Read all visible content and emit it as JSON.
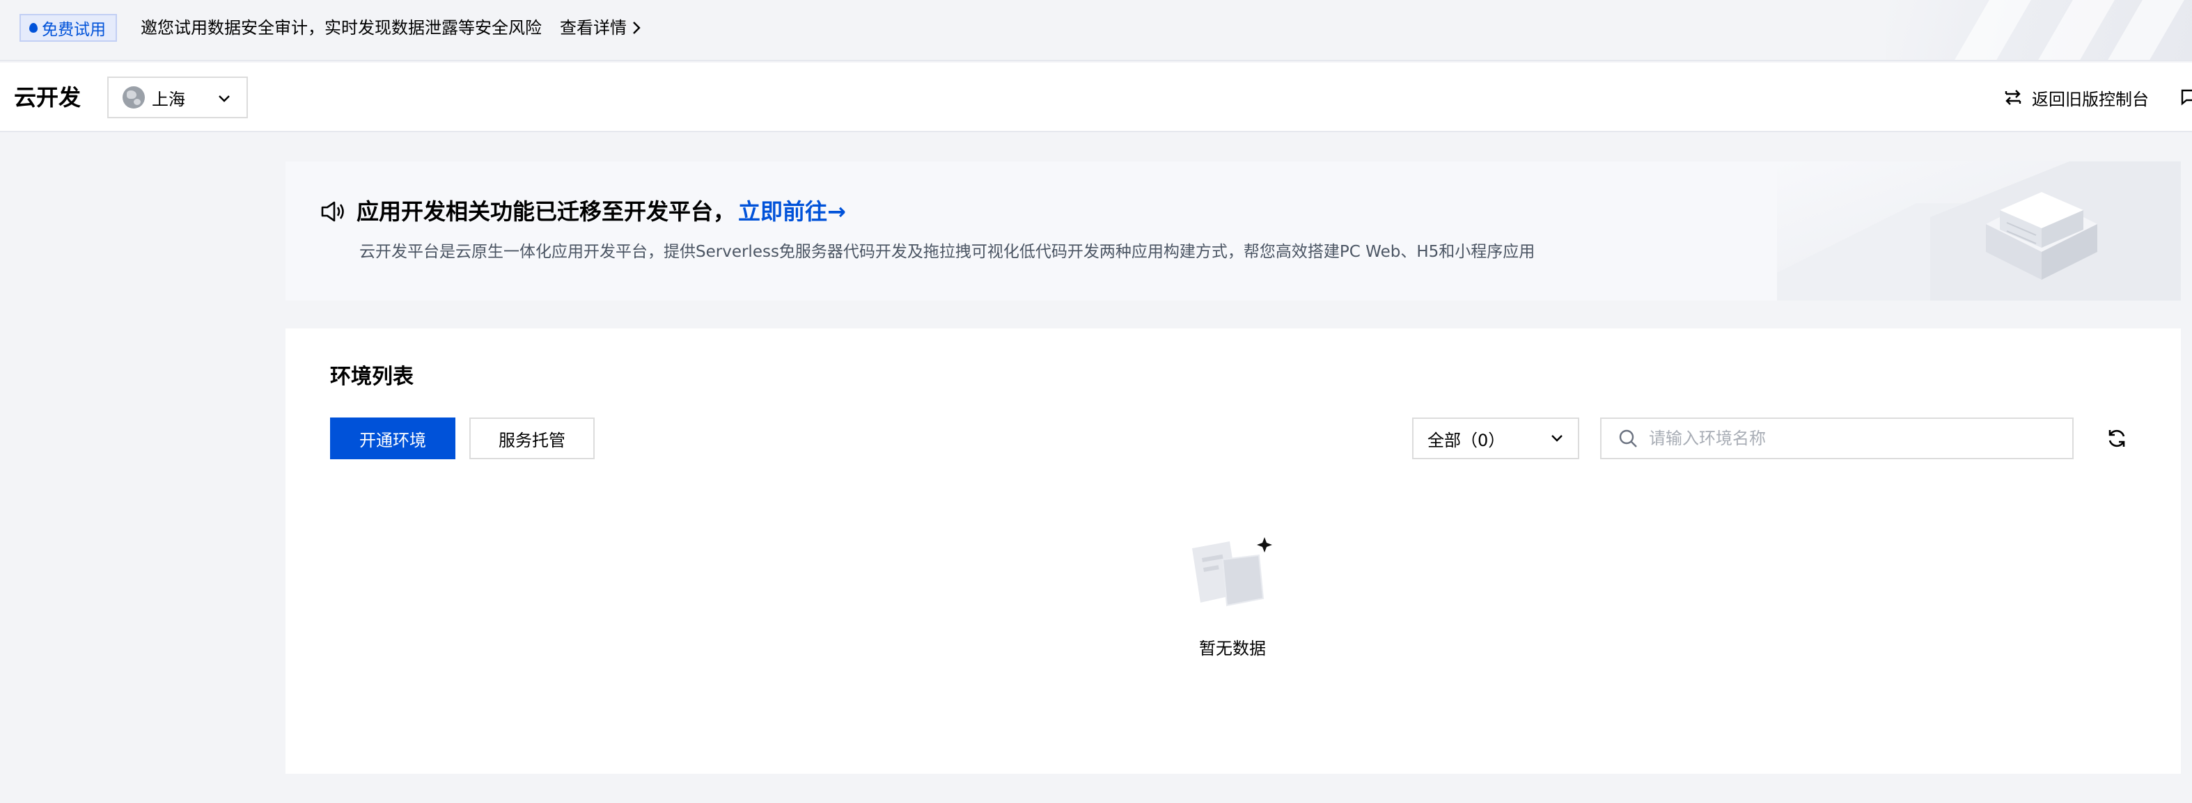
{
  "promo": {
    "tag": "免费试用",
    "text": "邀您试用数据安全审计，实时发现数据泄露等安全风险",
    "link": "查看详情"
  },
  "header": {
    "brand": "云开发",
    "region": "上海",
    "back_old": "返回旧版控制台"
  },
  "notice": {
    "title": "应用开发相关功能已迁移至开发平台，",
    "link": "立即前往→",
    "desc": "云开发平台是云原生一体化应用开发平台，提供Serverless免服务器代码开发及拖拉拽可视化低代码开发两种应用构建方式，帮您高效搭建PC Web、H5和小程序应用"
  },
  "env": {
    "title": "环境列表",
    "primary_button": "开通环境",
    "secondary_button": "服务托管",
    "filter": "全部（0）",
    "search_placeholder": "请输入环境名称",
    "empty": "暂无数据"
  },
  "colors": {
    "accent": "#0052d9",
    "page_bg": "#f3f4f7"
  }
}
